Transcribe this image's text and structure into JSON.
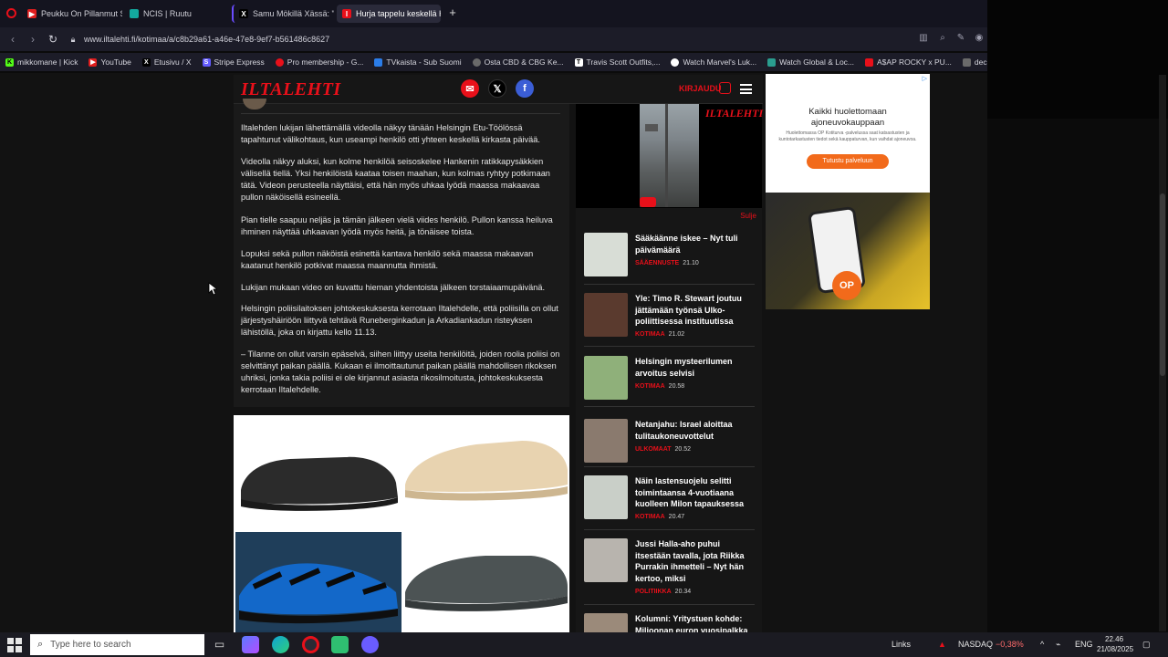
{
  "browser": {
    "tabs": [
      {
        "label": "Peukku On Pillanmut Suom",
        "color": "#e01e1e",
        "icon": "youtube-icon",
        "active": false
      },
      {
        "label": "NCIS | Ruutu",
        "color": "#13a89e",
        "icon": "ruutu-icon",
        "active": false
      },
      {
        "label": "Samu Mökillä Xässä: \"Min",
        "color": "#000000",
        "icon": "x-icon",
        "active": false
      },
      {
        "label": "Hurja tappelu keskellä He",
        "color": "#e8101a",
        "icon": "iltalehti-icon",
        "active": true
      }
    ],
    "new_tab": "+",
    "url": "www.iltalehti.fi/kotimaa/a/c8b29a61-a46e-47e8-9ef7-b561486c8627",
    "bookmarks": [
      {
        "label": "mikkomane | Kick",
        "color": "#53fc18",
        "icon": "kick-icon"
      },
      {
        "label": "YouTube",
        "color": "#e01e1e",
        "icon": "youtube-icon"
      },
      {
        "label": "Etusivu / X",
        "color": "#000000",
        "icon": "x-icon"
      },
      {
        "label": "Stripe Express",
        "color": "#635bff",
        "icon": "stripe-icon"
      },
      {
        "label": "Pro membership - G...",
        "color": "#e8101a",
        "icon": "pin-icon"
      },
      {
        "label": "TVkaista - Sub Suomi",
        "color": "#2b7de9",
        "icon": "tvkaista-icon"
      },
      {
        "label": "Osta CBD & CBG Ke...",
        "color": "#6a6a6a",
        "icon": "globe-icon"
      },
      {
        "label": "Travis Scott Outfits,...",
        "color": "#ffffff",
        "icon": "travis-icon"
      },
      {
        "label": "Watch Marvel's Luk...",
        "color": "#ffffff",
        "icon": "watch-icon"
      },
      {
        "label": "Watch Global & Loc...",
        "color": "#2a9d8f",
        "icon": "global-icon"
      },
      {
        "label": "A$AP ROCKY x PU...",
        "color": "#e8101a",
        "icon": "puma-icon"
      },
      {
        "label": "deceived - SUORAT...",
        "color": "#6a6a6a",
        "icon": "doc-icon"
      }
    ]
  },
  "site": {
    "logo": "ILTALEHTI",
    "login": "KIRJAUDU",
    "social": [
      {
        "name": "email",
        "color": "#e8101a",
        "glyph": "✉"
      },
      {
        "name": "x",
        "color": "#000000",
        "glyph": "𝕏"
      },
      {
        "name": "facebook",
        "color": "#3b5ed6",
        "glyph": "f"
      }
    ]
  },
  "article": {
    "paragraphs": [
      "Iltalehden lukijan lähettämällä videolla näkyy tänään Helsingin Etu-Töölössä tapahtunut välikohtaus, kun useampi henkilö otti yhteen keskellä kirkasta päivää.",
      "Videolla näkyy aluksi, kun kolme henkilöä seisoskelee Hankenin ratikkapysäkkien välisellä tiellä. Yksi henkilöistä kaataa toisen maahan, kun kolmas ryhtyy potkimaan tätä. Videon perusteella näyttäisi, että hän myös uhkaa lyödä maassa makaavaa pullon näköisellä esineellä.",
      "Pian tielle saapuu neljäs ja tämän jälkeen vielä viides henkilö. Pullon kanssa heiluva ihminen näyttää uhkaavan lyödä myös heitä, ja tönäisee toista.",
      "Lopuksi sekä pullon näköistä esinettä kantava henkilö sekä maassa makaavan kaatanut henkilö potkivat maassa maannutta ihmistä.",
      "Lukijan mukaan video on kuvattu hieman yhdentoista jälkeen torstaiaamupäivänä.",
      "Helsingin poliisilaitoksen johtokeskuksesta kerrotaan Iltalehdelle, että poliisilla on ollut järjestyshäiriöön liittyvä tehtävä Runeberginkadun ja Arkadiankadun risteyksen lähistöllä, joka on kirjattu kello 11.13.",
      "– Tilanne on ollut varsin epäselvä, siihen liittyy useita henkilöitä, joiden roolia poliisi on selvittänyt paikan päällä. Kukaan ei ilmoittautunut paikan päällä mahdollisen rikoksen uhriksi, jonka takia poliisi ei ole kirjannut asiasta rikosilmoitusta, johtokeskuksesta kerrotaan Iltalehdelle."
    ]
  },
  "video": {
    "logo": "ILTALEHTI",
    "more": "Sulje"
  },
  "news": [
    {
      "title": "Sääkäänne iskee – Nyt tuli päivämäärä",
      "category": "SÄÄENNUSTE",
      "time": "21.10",
      "thumb": "#d8ddd6"
    },
    {
      "title": "Yle: Timo R. Stewart joutuu jättämään työnsä Ulko-poliittisessa instituutissa",
      "category": "KOTIMAA",
      "time": "21.02",
      "thumb": "#5a3a2e"
    },
    {
      "title": "Helsingin mysteerilumen arvoitus selvisi",
      "category": "KOTIMAA",
      "time": "20.58",
      "thumb": "#8fb07a"
    },
    {
      "title": "Netanjahu: Israel aloittaa tulitaukoneuvottelut",
      "category": "ULKOMAAT",
      "time": "20.52",
      "thumb": "#8a7a6e"
    },
    {
      "title": "Näin lastensuojelu selitti toimintaansa 4-vuotiaana kuolleen Milon tapauksessa",
      "category": "KOTIMAA",
      "time": "20.47",
      "thumb": "#c9cfc8"
    },
    {
      "title": "Jussi Halla-aho puhui itsestään tavalla, jota Riikka Purrakin ihmetteli – Nyt hän kertoo, miksi",
      "category": "POLITIIKKA",
      "time": "20.34",
      "thumb": "#b8b4ae"
    },
    {
      "title": "Kolumni: Yritystuen kohde: Miljoonan euron vuosipalkka",
      "category": "",
      "time": "",
      "thumb": "#9b8a7a"
    }
  ],
  "ads": {
    "right_text": "Kaikki huolettomaan ajoneuvokauppaan",
    "right_small": "Huolettomassa OP Kotiturva -palvelussa saat katsastusten ja kuntotarkastusten tiedot sekä kauppaturvan, kun vaihdat ajoneuvoa.",
    "right_cta": "Tutustu palveluun",
    "op_logo": "OP",
    "ad_choice": "▷"
  },
  "taskbar": {
    "search_placeholder": "Type here to search",
    "links": "Links",
    "ticker_name": "NASDAQ",
    "ticker_change": "−0,38%",
    "lang": "ENG",
    "time": "22.46",
    "date": "21/08/2025"
  }
}
